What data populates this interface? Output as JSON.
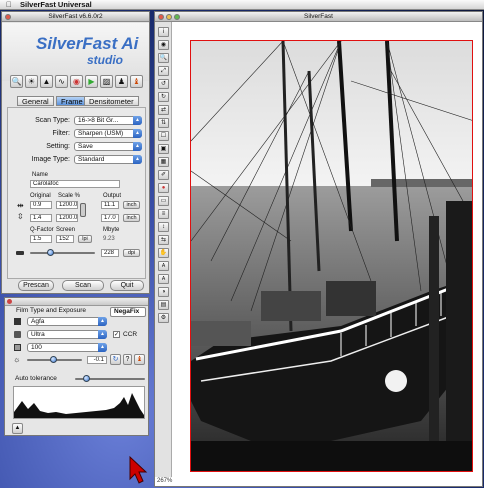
{
  "menubar": {
    "app_name": "SilverFast Universal"
  },
  "control_window": {
    "title": "SilverFast v6.6.0r2",
    "logo_line1": "SilverFast Ai",
    "logo_line2": "studio",
    "tabs": [
      {
        "label": "General"
      },
      {
        "label": "Frame"
      },
      {
        "label": "Densitometer"
      }
    ],
    "active_tab": "Frame",
    "scan_type": {
      "label": "Scan Type:",
      "value": "16->8 Bit Gr..."
    },
    "filter": {
      "label": "Filter:",
      "value": "Sharpen (USM)"
    },
    "setting": {
      "label": "Setting:",
      "value": "Save"
    },
    "image_type": {
      "label": "Image Type:",
      "value": "Standard"
    },
    "name": {
      "label": "Name",
      "value": "Carolafoc"
    },
    "headers": {
      "original": "Original",
      "scale": "Scale %",
      "output": "Output"
    },
    "width": {
      "original": "0.9",
      "scale": "1200.0",
      "output": "11.1",
      "unit": "inch"
    },
    "height": {
      "original": "1.4",
      "scale": "1200.0",
      "output": "17.0",
      "unit": "inch"
    },
    "qfactor": {
      "label": "Q-Factor",
      "value": "1.5"
    },
    "screen": {
      "label": "Screen",
      "value": "152",
      "unit": "lpi"
    },
    "mbyte": {
      "label": "Mbyte",
      "value": "9.23"
    },
    "resolution": {
      "value": "228",
      "unit": "dpi"
    },
    "buttons": {
      "prescan": "Prescan",
      "scan": "Scan",
      "quit": "Quit"
    }
  },
  "film_panel": {
    "title": "Film Type and Exposure",
    "mode": "NegaFix",
    "manufacturer": "Agfa",
    "film_type": "Ultra",
    "iso": "100",
    "ccr_label": "CCR",
    "ccr_checked": true,
    "exposure_value": "-0.1",
    "auto_tolerance_label": "Auto tolerance"
  },
  "preview_window": {
    "title": "SilverFast",
    "zoom": "267%"
  },
  "colors": {
    "accent": "#3a78d2",
    "frame_red": "#e01010"
  }
}
